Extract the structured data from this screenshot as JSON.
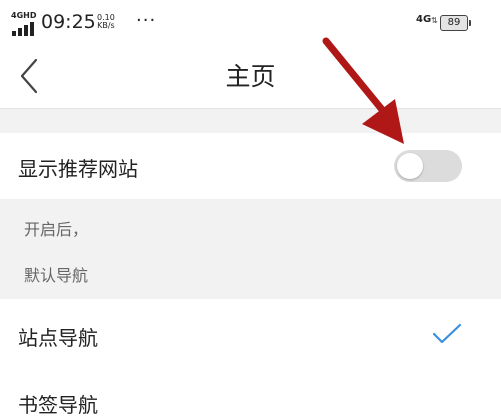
{
  "status_bar": {
    "network_left": "4GHD",
    "time": "09:25",
    "speed_value": "0.10",
    "speed_unit": "KB/s",
    "menu_dots": "···",
    "network_right": "4G",
    "battery": "89"
  },
  "header": {
    "title": "主页"
  },
  "settings": {
    "show_recommended_label": "显示推荐网站",
    "show_recommended_enabled": false,
    "description_line1": "开启后，",
    "description_line2": "默认导航",
    "site_nav_label": "站点导航",
    "site_nav_selected": true,
    "bookmark_nav_label": "书签导航"
  },
  "colors": {
    "accent": "#3b8fe0",
    "annotation_arrow": "#b01818",
    "toggle_off": "#dcdcdc",
    "section_bg": "#f2f2f2"
  }
}
